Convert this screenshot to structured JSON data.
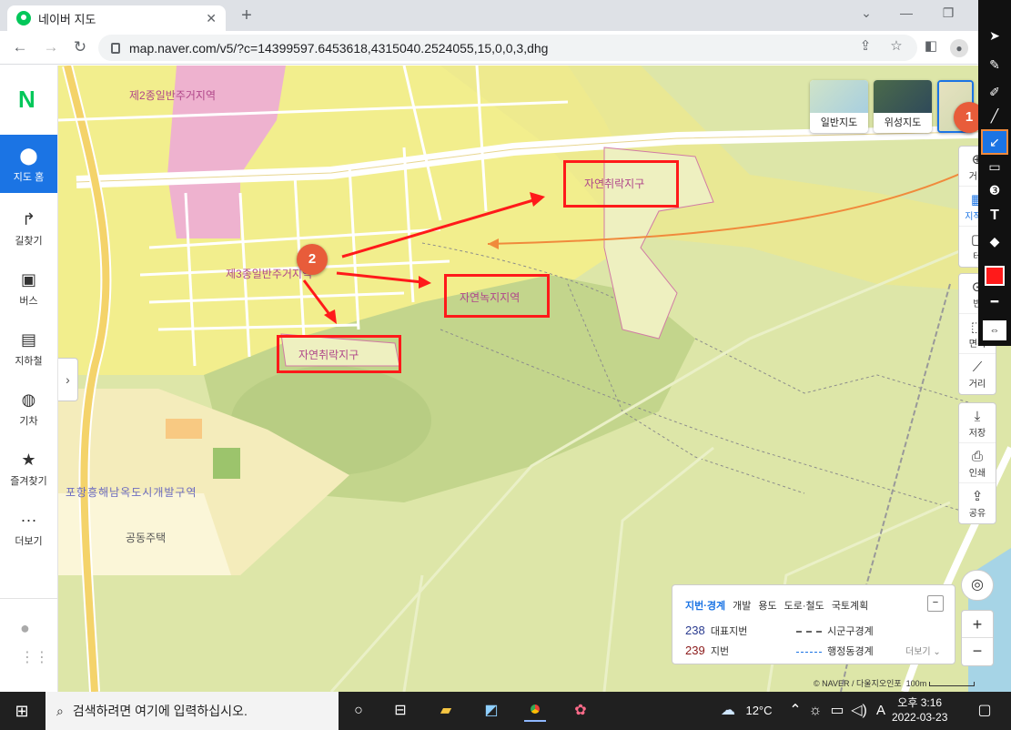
{
  "browser": {
    "tab_title": "네이버 지도",
    "url": "map.naver.com/v5/?c=14399597.6453618,4315040.2524055,15,0,0,3,dhg"
  },
  "sidebar": {
    "logo": "N",
    "items": [
      {
        "label": "지도 홈",
        "icon": "map-pin-icon"
      },
      {
        "label": "길찾기",
        "icon": "turn-arrow-icon"
      },
      {
        "label": "버스",
        "icon": "bus-icon"
      },
      {
        "label": "지하철",
        "icon": "subway-icon"
      },
      {
        "label": "기차",
        "icon": "train-icon"
      },
      {
        "label": "즐겨찾기",
        "icon": "star-icon"
      },
      {
        "label": "더보기",
        "icon": "more-icon"
      }
    ]
  },
  "map": {
    "labels": {
      "zone1": "제2종일반주거지역",
      "zone2": "제3종일반주거지역",
      "zone3": "포항흥해남옥도시개발구역",
      "housing": "공동주택",
      "box1": "자연취락지구",
      "box2": "자연녹지지역",
      "box3": "자연취락지구"
    },
    "badges": {
      "b1": "1",
      "b2": "2"
    },
    "layers": {
      "normal": "일반지도",
      "satellite": "위성지도"
    },
    "tools": {
      "t1": "거리",
      "t2": "지적편",
      "t3": "테",
      "t4": "반",
      "t5": "면적",
      "t6": "거리",
      "save": "저장",
      "print": "인쇄",
      "share": "공유"
    }
  },
  "legend": {
    "tabs": [
      "지번·경계",
      "개발",
      "용도",
      "도로·철도",
      "국토계획"
    ],
    "num1": "238",
    "lbl1": "대표지번",
    "num2": "239",
    "lbl2": "지번",
    "b1": "시군구경계",
    "b2": "행정동경계",
    "more": "더보기 ⌄"
  },
  "scale": {
    "attribution": "© NAVER / 다울지오인포",
    "distance": "100m"
  },
  "taskbar": {
    "search_placeholder": "검색하려면 여기에 입력하십시오.",
    "weather": "12°C",
    "ime": "A",
    "time": "오후 3:16",
    "date": "2022-03-23"
  },
  "colors": {
    "accent": "#1b74e4",
    "annotation_red": "#ff1a1a",
    "annotation_orange": "#f08a3c",
    "naver_green": "#03c75a"
  }
}
